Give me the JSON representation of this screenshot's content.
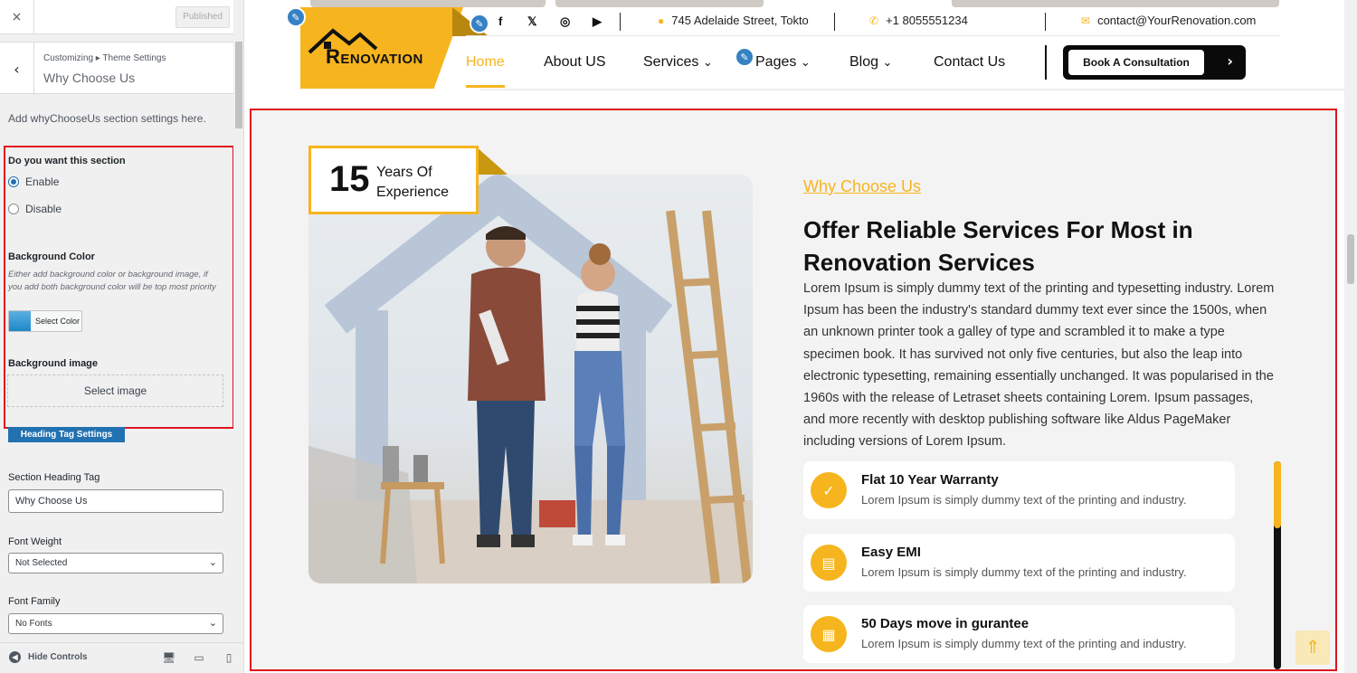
{
  "sidebar": {
    "close_icon": "×",
    "published_label": "Published",
    "breadcrumb": "Customizing ▸ Theme Settings",
    "title": "Why Choose Us",
    "description": "Add whyChooseUs section settings here.",
    "section_toggle_label": "Do you want this section",
    "options": {
      "enable": "Enable",
      "disable": "Disable",
      "selected": "Enable"
    },
    "bg_color_label": "Background Color",
    "bg_color_note": "Either add background color or background image, if you add both background color will be top most priority",
    "select_color_label": "Select Color",
    "bg_image_label": "Background image",
    "select_image_label": "Select image",
    "heading_tag_button": "Heading Tag Settings",
    "section_heading_tag_label": "Section Heading Tag",
    "section_heading_tag_value": "Why Choose Us",
    "font_weight_label": "Font Weight",
    "font_weight_value": "Not Selected",
    "font_family_label": "Font Family",
    "font_family_value": "No Fonts",
    "hide_controls_label": "Hide Controls"
  },
  "site": {
    "logo_text": "ENOVATION",
    "logo_initial": "R",
    "address": "745 Adelaide Street, Tokto",
    "phone": "+1 8055551234",
    "email": "contact@YourRenovation.com",
    "social": {
      "facebook": "f",
      "x": "𝕏",
      "instagram": "◎",
      "youtube": "▶"
    },
    "nav": {
      "home": "Home",
      "about": "About US",
      "services": "Services",
      "pages": "Pages",
      "blog": "Blog",
      "contact": "Contact Us"
    },
    "cta": "Book A Consultation",
    "accent_color": "#f6b51e"
  },
  "why": {
    "badge_number": "15",
    "badge_line1": "Years Of",
    "badge_line2": "Experience",
    "eyebrow": "Why Choose Us",
    "heading": "Offer Reliable Services For Most in Renovation Services",
    "paragraph": "Lorem Ipsum is simply dummy text of the printing and typesetting industry. Lorem Ipsum has been the industry's standard dummy text ever since the 1500s, when an unknown printer took a galley of type and scrambled it to make a type specimen book. It has survived not only five centuries, but also the leap into electronic typesetting, remaining essentially unchanged. It was popularised in the 1960s with the release of Letraset sheets containing Lorem. Ipsum passages, and more recently with desktop publishing software like Aldus PageMaker including versions of Lorem Ipsum.",
    "features": [
      {
        "title": "Flat 10 Year Warranty",
        "desc": "Lorem Ipsum is simply dummy text of the printing and industry.",
        "icon": "check-badge-icon"
      },
      {
        "title": "Easy EMI",
        "desc": "Lorem Ipsum is simply dummy text of the printing and industry.",
        "icon": "document-icon"
      },
      {
        "title": "50 Days move in gurantee",
        "desc": "Lorem Ipsum is simply dummy text of the printing and industry.",
        "icon": "building-icon"
      }
    ]
  }
}
